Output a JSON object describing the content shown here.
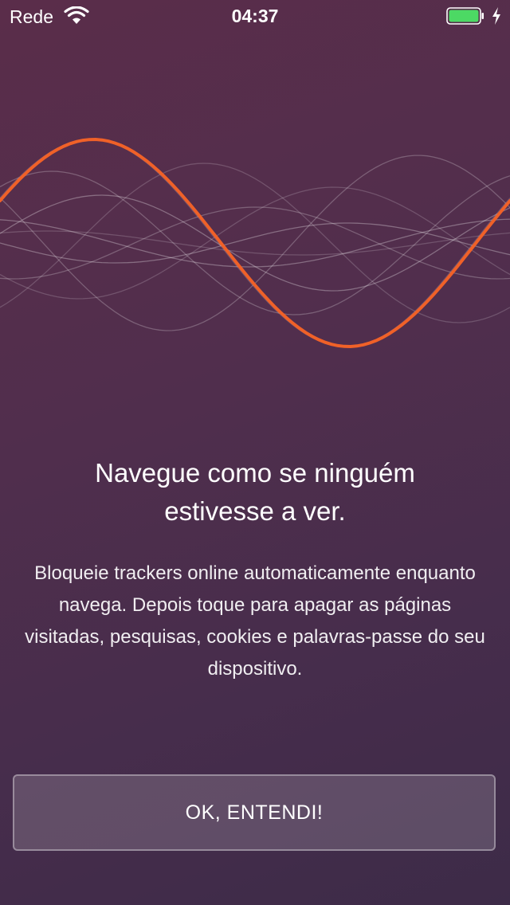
{
  "status_bar": {
    "carrier": "Rede",
    "time": "04:37",
    "wifi_icon": "wifi-icon",
    "battery_icon": "battery-icon",
    "charging_icon": "charging-bolt-icon",
    "battery_level": 1.0,
    "battery_color": "#4cd964"
  },
  "intro": {
    "headline": "Navegue como se ninguém\nestivesse a ver.",
    "description": "Bloqueie trackers online automaticamente enquanto navega. Depois toque para apagar as páginas visitadas, pesquisas, cookies e palavras-passe do seu dispositivo.",
    "wave_illustration": "sound-wave-illustration",
    "accent_color": "#f06128"
  },
  "actions": {
    "ok_label": "OK, ENTENDI!"
  }
}
